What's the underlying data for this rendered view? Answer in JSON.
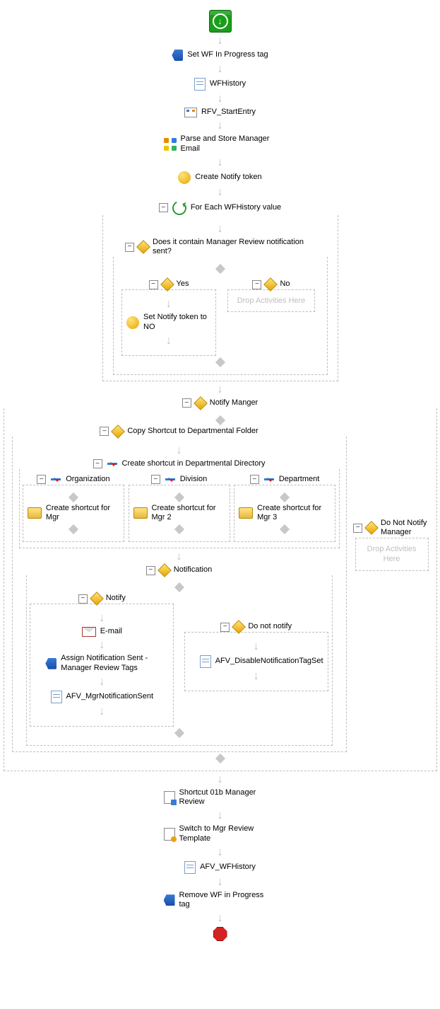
{
  "start": {},
  "end": {},
  "nodes": {
    "set_wf_in_progress": "Set WF In Progress tag",
    "wf_history": "WFHistory",
    "rfv_start_entry": "RFV_StartEntry",
    "parse_store_mgr_email": "Parse and Store Manager Email",
    "create_notify_token": "Create Notify token",
    "foreach_label": "For Each WFHistory value",
    "q_contains_mgr_review": "Does it contain Manager Review notification sent?",
    "yes": "Yes",
    "no": "No",
    "set_notify_token_no": "Set Notify token to NO",
    "drop_here": "Drop Activities Here",
    "notify_manager": "Notify Manger",
    "copy_shortcut_dept": "Copy Shortcut to Departmental Folder",
    "create_shortcut_dir": "Create shortcut in Departmental Directory",
    "org": "Organization",
    "division": "Division",
    "department": "Department",
    "create_shortcut_mgr": "Create shortcut for Mgr",
    "create_shortcut_mgr2": "Create shortcut for Mgr 2",
    "create_shortcut_mgr3": "Create shortcut for Mgr 3",
    "notification": "Notification",
    "notify": "Notify",
    "email": "E-mail",
    "assign_tags": "Assign Notification Sent - Manager Review Tags",
    "afv_mgr_notif_sent": "AFV_MgrNotificationSent",
    "do_not_notify": "Do not notify",
    "afv_disable_notif_tag": "AFV_DisableNotificationTagSet",
    "do_not_notify_manager": "Do Not Notify Manager",
    "shortcut_01b": "Shortcut 01b Manager Review",
    "switch_tmpl": "Switch to Mgr Review Template",
    "afv_wfhistory": "AFV_WFHistory",
    "remove_wf_tag": "Remove WF in Progress tag"
  },
  "collapse_glyph": "−"
}
